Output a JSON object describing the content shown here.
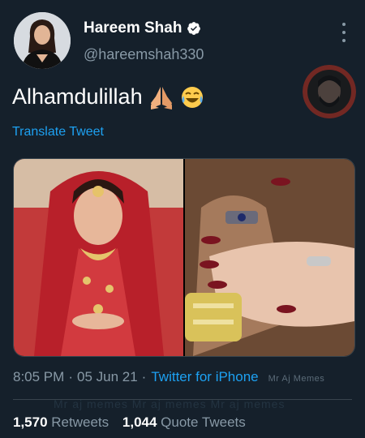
{
  "user": {
    "name": "Hareem Shah",
    "handle": "@hareemshah330"
  },
  "tweet": {
    "text": "Alhamdulillah",
    "translate_label": "Translate Tweet",
    "time": "8:05 PM",
    "date": "05 Jun 21",
    "source": "Twitter for iPhone",
    "separator": "·"
  },
  "watermark": {
    "meta_mark": "Mr Aj Memes",
    "ghost_text": "Mr aj memes Mr aj memes Mr aj memes"
  },
  "stats": {
    "retweets_count": "1,570",
    "retweets_label": "Retweets",
    "quotes_count": "1,044",
    "quotes_label": "Quote Tweets"
  },
  "colors": {
    "background": "#15202b",
    "accent": "#1da1f2",
    "muted": "#8899a6",
    "verified": "#ffffff"
  },
  "icons": [
    "verified-badge-icon",
    "more-options-icon",
    "folded-hands-emoji",
    "tears-of-joy-emoji"
  ]
}
